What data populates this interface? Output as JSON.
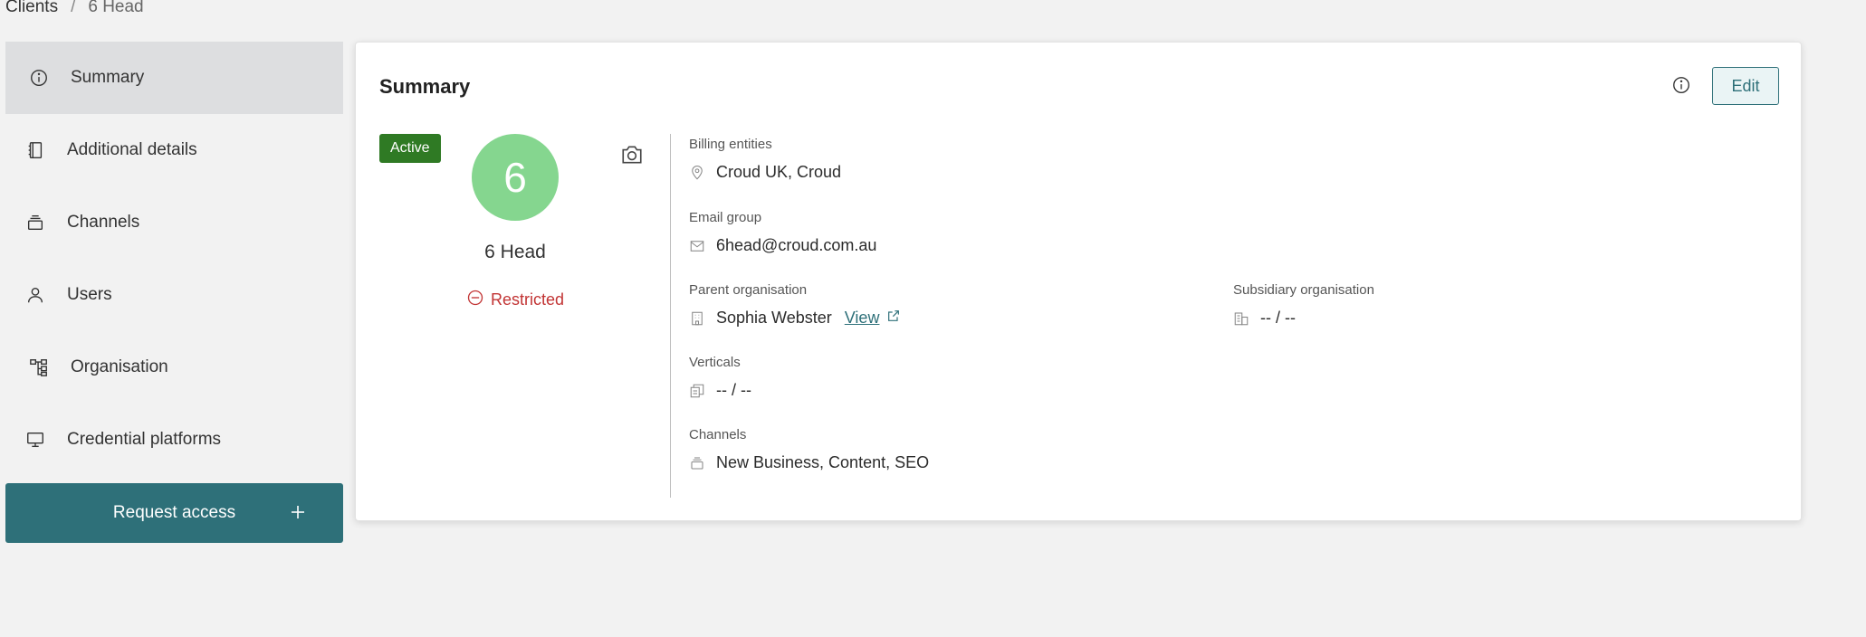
{
  "breadcrumb": {
    "root": "Clients",
    "separator": "/",
    "current": "6 Head"
  },
  "sidebar": {
    "items": [
      {
        "label": "Summary",
        "icon": "info-icon",
        "active": true
      },
      {
        "label": "Additional details",
        "icon": "notebook-icon"
      },
      {
        "label": "Channels",
        "icon": "stack-icon"
      },
      {
        "label": "Users",
        "icon": "user-icon"
      },
      {
        "label": "Organisation",
        "icon": "org-chart-icon"
      },
      {
        "label": "Credential platforms",
        "icon": "monitor-icon"
      }
    ],
    "request_access": "Request access"
  },
  "card": {
    "title": "Summary",
    "edit_label": "Edit",
    "status_badge": "Active",
    "avatar_initial": "6",
    "client_name": "6 Head",
    "access_state": "Restricted",
    "billing": {
      "label": "Billing entities",
      "value": "Croud UK, Croud"
    },
    "email": {
      "label": "Email group",
      "value": "6head@croud.com.au"
    },
    "parent": {
      "label": "Parent organisation",
      "value": "Sophia Webster",
      "link": "View"
    },
    "subsidiary": {
      "label": "Subsidiary organisation",
      "value": "-- / --"
    },
    "verticals": {
      "label": "Verticals",
      "value": "-- / --"
    },
    "channels": {
      "label": "Channels",
      "value": "New Business, Content, SEO"
    }
  },
  "colors": {
    "primary": "#2e7079",
    "active_badge": "#2f7a24",
    "avatar": "#85d68f",
    "restricted": "#c23434",
    "background": "#f2f2f2"
  }
}
